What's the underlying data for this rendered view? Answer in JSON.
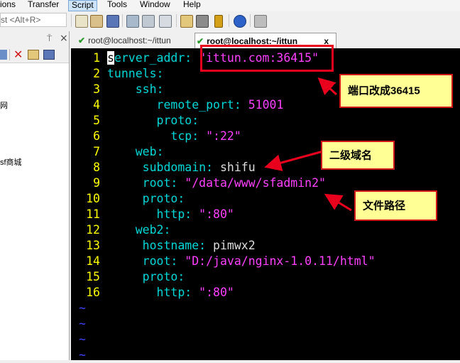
{
  "menu": [
    "ions",
    "Transfer",
    "Script",
    "Tools",
    "Window",
    "Help"
  ],
  "menu_active": "Script",
  "toolbar": {
    "quick_connect_placeholder": "st <Alt+R>"
  },
  "left_pane": {
    "pin_glyph": "⍑",
    "close_glyph": "×",
    "items": [
      "网",
      "sf商城"
    ]
  },
  "tabs": [
    {
      "label": "root@localhost:~/ittun",
      "active": false
    },
    {
      "label": "root@localhost:~/ittun",
      "active": true,
      "close": "x"
    }
  ],
  "terminal": {
    "lines": [
      {
        "n": "1",
        "indent": "",
        "key": "server_addr",
        "sep": ": ",
        "value": "\"ittun.com:36415\"",
        "kind": "str"
      },
      {
        "n": "2",
        "indent": "",
        "key": "tunnels",
        "sep": ":",
        "value": "",
        "kind": ""
      },
      {
        "n": "3",
        "indent": "    ",
        "key": "ssh",
        "sep": ":",
        "value": "",
        "kind": ""
      },
      {
        "n": "4",
        "indent": "       ",
        "key": "remote_port",
        "sep": ": ",
        "value": "51001",
        "kind": "num"
      },
      {
        "n": "5",
        "indent": "       ",
        "key": "proto",
        "sep": ":",
        "value": "",
        "kind": ""
      },
      {
        "n": "6",
        "indent": "         ",
        "key": "tcp",
        "sep": ": ",
        "value": "\":22\"",
        "kind": "str"
      },
      {
        "n": "7",
        "indent": "    ",
        "key": "web",
        "sep": ":",
        "value": "",
        "kind": ""
      },
      {
        "n": "8",
        "indent": "     ",
        "key": "subdomain",
        "sep": ": ",
        "value": "shifu",
        "kind": "val"
      },
      {
        "n": "9",
        "indent": "     ",
        "key": "root",
        "sep": ": ",
        "value": "\"/data/www/sfadmin2\"",
        "kind": "str"
      },
      {
        "n": "10",
        "indent": "     ",
        "key": "proto",
        "sep": ":",
        "value": "",
        "kind": ""
      },
      {
        "n": "11",
        "indent": "       ",
        "key": "http",
        "sep": ": ",
        "value": "\":80\"",
        "kind": "str"
      },
      {
        "n": "12",
        "indent": "    ",
        "key": "web2",
        "sep": ":",
        "value": "",
        "kind": ""
      },
      {
        "n": "13",
        "indent": "     ",
        "key": "hostname",
        "sep": ": ",
        "value": "pimwx2",
        "kind": "val"
      },
      {
        "n": "14",
        "indent": "     ",
        "key": "root",
        "sep": ": ",
        "value": "\"D:/java/nginx-1.0.11/html\"",
        "kind": "str"
      },
      {
        "n": "15",
        "indent": "     ",
        "key": "proto",
        "sep": ":",
        "value": "",
        "kind": ""
      },
      {
        "n": "16",
        "indent": "       ",
        "key": "http",
        "sep": ": ",
        "value": "\":80\"",
        "kind": "str"
      }
    ],
    "tilde": "~"
  },
  "annotations": {
    "port_note": "端口改成36415",
    "subdomain_note": "二级域名",
    "path_note": "文件路径"
  },
  "colors": {
    "line_number": "#ffff00",
    "key": "#00d7d7",
    "string": "#ff40ff",
    "highlight_box": "#e8001c",
    "callout_bg": "#ffff96",
    "arrow": "#e8001c"
  }
}
